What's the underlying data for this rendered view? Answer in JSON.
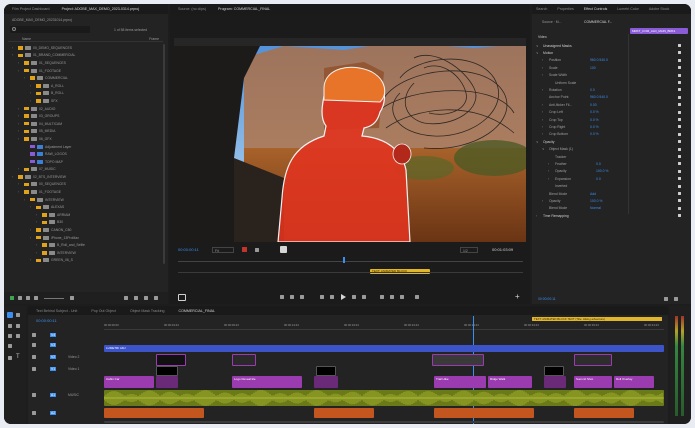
{
  "project": {
    "tabs": [
      "Film Project Dashboard",
      "Project: ADOBE_MAX_DEMO_2023-0314.prproj"
    ],
    "path": "ADOBE_MAX_DEMO_20231014.prproj",
    "selection_info": "1 of 58 items selected",
    "col_name": "Name",
    "col_frame": "Frame",
    "items": [
      {
        "label": "00_DEMO_SEQUENCES",
        "indent": 0,
        "kind": "folder",
        "color": "#e0a21b"
      },
      {
        "label": "01_BRAND_COMMERCIAL",
        "indent": 0,
        "kind": "folder",
        "color": "#e0a21b"
      },
      {
        "label": "01_SEQUENCES",
        "indent": 1,
        "kind": "folder",
        "color": "#e0a21b"
      },
      {
        "label": "01_FOOTAGE",
        "indent": 1,
        "kind": "folder",
        "color": "#e0a21b"
      },
      {
        "label": "COMMERCIAL",
        "indent": 2,
        "kind": "folder",
        "color": "#e0a21b"
      },
      {
        "label": "A_ROLL",
        "indent": 3,
        "kind": "folder",
        "color": "#e0a21b"
      },
      {
        "label": "B_ROLL",
        "indent": 3,
        "kind": "folder",
        "color": "#e0a21b"
      },
      {
        "label": "SFX",
        "indent": 3,
        "kind": "folder",
        "color": "#e0a21b"
      },
      {
        "label": "02_AUDIO",
        "indent": 1,
        "kind": "folder",
        "color": "#e0a21b"
      },
      {
        "label": "03_GROUPS",
        "indent": 1,
        "kind": "folder",
        "color": "#e0a21b"
      },
      {
        "label": "04_MULTICAM",
        "indent": 1,
        "kind": "folder",
        "color": "#e0a21b"
      },
      {
        "label": "05_MEDIA",
        "indent": 1,
        "kind": "folder",
        "color": "#e0a21b"
      },
      {
        "label": "06_GFX",
        "indent": 1,
        "kind": "folder",
        "color": "#e0a21b"
      },
      {
        "label": "Adjustment Layer",
        "indent": 2,
        "kind": "item",
        "color": "#8a5bd6"
      },
      {
        "label": "RAW_LOGOS",
        "indent": 2,
        "kind": "item",
        "color": "#8a5bd6"
      },
      {
        "label": "TOPO MAP",
        "indent": 2,
        "kind": "item",
        "color": "#8a5bd6"
      },
      {
        "label": "07_MUSIC",
        "indent": 1,
        "kind": "folder",
        "color": "#e0a21b"
      },
      {
        "label": "02_BTS_INTERVIEW",
        "indent": 0,
        "kind": "folder",
        "color": "#e0a21b"
      },
      {
        "label": "00_SEQUENCES",
        "indent": 1,
        "kind": "folder",
        "color": "#e0a21b"
      },
      {
        "label": "01_FOOTAGE",
        "indent": 1,
        "kind": "folder",
        "color": "#e0a21b"
      },
      {
        "label": "INTERVIEW",
        "indent": 2,
        "kind": "folder",
        "color": "#e0a21b"
      },
      {
        "label": "ALEXAS",
        "indent": 3,
        "kind": "folder",
        "color": "#e0a21b"
      },
      {
        "label": "ARRIAM",
        "indent": 4,
        "kind": "folder",
        "color": "#e0a21b"
      },
      {
        "label": "B30",
        "indent": 4,
        "kind": "folder",
        "color": "#e0a21b"
      },
      {
        "label": "CANON_C80",
        "indent": 3,
        "kind": "folder",
        "color": "#e0a21b"
      },
      {
        "label": "iPhone_13ProMax",
        "indent": 3,
        "kind": "folder",
        "color": "#e0a21b"
      },
      {
        "label": "B_Roll_and_Selfie",
        "indent": 4,
        "kind": "folder",
        "color": "#e0a21b"
      },
      {
        "label": "INTERVIEW",
        "indent": 4,
        "kind": "folder",
        "color": "#e0a21b"
      },
      {
        "label": "GREEN_06_S",
        "indent": 3,
        "kind": "folder",
        "color": "#e0a21b"
      }
    ]
  },
  "source_tab": "Source: (no clips)",
  "program_tab": "Program: COMMERCIAL_FINAL",
  "program": {
    "timecode_left": "00:00:00:11",
    "timecode_right": "00:01:03:09",
    "fit_label": "Fit",
    "quality_label": "1/2",
    "marker_label": "TEXT: ANIMATED BLOCK"
  },
  "effects": {
    "tabs": [
      "Search",
      "Properties",
      "Effect Controls",
      "Lumetri Color",
      "Adobe Stock"
    ],
    "source_label": "Source · M...",
    "sequence_label": "COMMERCIAL F...",
    "clip_label": "MRKT_COM_ALD_MAIN_BRK1",
    "section_video": "Video",
    "rows": [
      {
        "label": "Unassigned Masks",
        "value": "",
        "indent": 0,
        "caret": "∨"
      },
      {
        "label": "Motion",
        "value": "",
        "indent": 0,
        "caret": "∨"
      },
      {
        "label": "Position",
        "value": "960.0    540.0",
        "indent": 1,
        "caret": "›"
      },
      {
        "label": "Scale",
        "value": "100",
        "indent": 1,
        "caret": "›"
      },
      {
        "label": "Scale Width",
        "value": "",
        "indent": 1,
        "caret": "›"
      },
      {
        "label": "Uniform Scale",
        "value": "",
        "indent": 2,
        "caret": ""
      },
      {
        "label": "Rotation",
        "value": "0.0",
        "indent": 1,
        "caret": "›"
      },
      {
        "label": "Anchor Point",
        "value": "960.0    540.0",
        "indent": 1,
        "caret": ""
      },
      {
        "label": "Anti-flicker Fil...",
        "value": "0.00",
        "indent": 1,
        "caret": "›"
      },
      {
        "label": "Crop Left",
        "value": "0.0 %",
        "indent": 1,
        "caret": "›"
      },
      {
        "label": "Crop Top",
        "value": "0.0 %",
        "indent": 1,
        "caret": "›"
      },
      {
        "label": "Crop Right",
        "value": "0.0 %",
        "indent": 1,
        "caret": "›"
      },
      {
        "label": "Crop Bottom",
        "value": "0.0 %",
        "indent": 1,
        "caret": "›"
      },
      {
        "label": "Opacity",
        "value": "",
        "indent": 0,
        "caret": "∨"
      },
      {
        "label": "Object Mask (1)",
        "value": "",
        "indent": 1,
        "caret": "∨"
      },
      {
        "label": "Tracker",
        "value": "",
        "indent": 2,
        "caret": ""
      },
      {
        "label": "Feather",
        "value": "0.0",
        "indent": 2,
        "caret": "›"
      },
      {
        "label": "Opacity",
        "value": "100.0 %",
        "indent": 2,
        "caret": "›"
      },
      {
        "label": "Expansion",
        "value": "0.0",
        "indent": 2,
        "caret": "›"
      },
      {
        "label": "Inverted",
        "value": "",
        "indent": 2,
        "caret": ""
      },
      {
        "label": "Blend Mode",
        "value": "Add",
        "indent": 1,
        "caret": ""
      },
      {
        "label": "Opacity",
        "value": "100.0 %",
        "indent": 1,
        "caret": "›"
      },
      {
        "label": "Blend Mode",
        "value": "Normal",
        "indent": 1,
        "caret": ""
      },
      {
        "label": "Time Remapping",
        "value": "",
        "indent": 0,
        "caret": "›"
      }
    ],
    "footer_tc": "00:00:00:11"
  },
  "timeline": {
    "tabs": [
      "Text Behind Subject - Unit",
      "Pop Out Object",
      "Object Mask Tracking",
      "COMMERCIAL_FINAL"
    ],
    "timecode": "00:00:00:11",
    "ruler": [
      "00:00:00:00",
      "00:00:04:23",
      "00:00:09:23",
      "00:00:14:23",
      "00:00:19:23",
      "00:00:24:23",
      "00:00:29:23",
      "00:00:34:23",
      "00:00:39:23",
      "00:00:44:23"
    ],
    "marker_label": "TEXT: ANIMATED BLOCK TEXT (Title: Hiking adventure)",
    "tracks": [
      {
        "name": "V4",
        "label": ""
      },
      {
        "name": "V3",
        "label": ""
      },
      {
        "name": "V2",
        "label": "Video 2"
      },
      {
        "name": "V1",
        "label": "Video 1"
      },
      {
        "name": "A1",
        "label": "MUSIC"
      },
      {
        "name": "A2",
        "label": ""
      }
    ],
    "clip_labels": {
      "lumetri": "LUMETRI ADJ",
      "v1a": "Cabin Car",
      "v1b": "Logo Reveal tile",
      "v1c": "Trail Hike",
      "v1d": "Ridge Walk",
      "v1e": "Summit Shot",
      "v1f": "Roll Overlay"
    }
  },
  "colors": {
    "accent": "#3b8ff0",
    "mask_red": "#e0341f",
    "marker_yellow": "#e2b62b",
    "clip_magenta": "#9b3bb0",
    "clip_blue": "#3d54c9",
    "audio_green": "#6b7a19",
    "audio_orange": "#c2561e"
  }
}
